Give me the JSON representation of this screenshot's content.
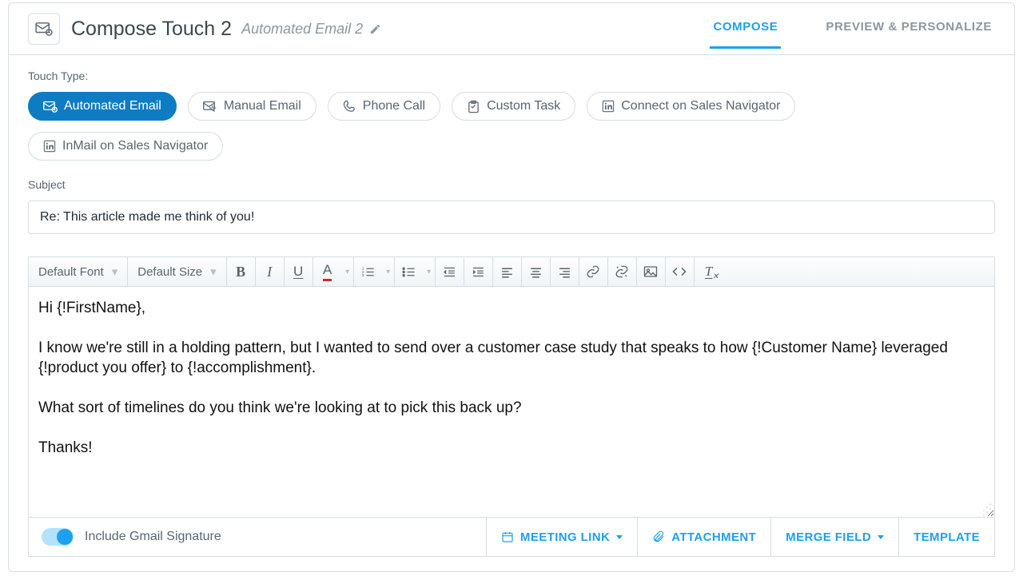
{
  "header": {
    "title": "Compose Touch 2",
    "subtitle": "Automated Email 2"
  },
  "tabs": {
    "compose": "COMPOSE",
    "preview": "PREVIEW & PERSONALIZE"
  },
  "touchType": {
    "label": "Touch Type:",
    "options": {
      "automated": "Automated Email",
      "manual": "Manual Email",
      "phone": "Phone Call",
      "custom": "Custom Task",
      "connect": "Connect on Sales Navigator",
      "inmail": "InMail on Sales Navigator"
    }
  },
  "subject": {
    "label": "Subject",
    "value": "Re: This article made me think of you!"
  },
  "toolbar": {
    "font": "Default Font",
    "size": "Default Size"
  },
  "body": {
    "p1": "Hi {!FirstName},",
    "p2": "I know we're still in a holding pattern, but I wanted to send over a customer case study that speaks to how {!Customer Name} leveraged {!product you offer} to {!accomplishment}.",
    "p3": "What sort of timelines do you think we're looking at to pick this back up?",
    "p4": "Thanks!"
  },
  "footer": {
    "signature": "Include Gmail Signature",
    "meeting": "MEETING LINK",
    "attachment": "ATTACHMENT",
    "merge": "MERGE FIELD",
    "template": "TEMPLATE"
  }
}
